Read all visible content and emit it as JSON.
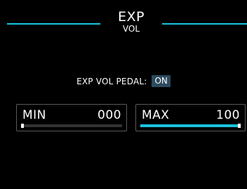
{
  "colors": {
    "accent": "#19c3df",
    "background": "#000000"
  },
  "header": {
    "title": "EXP",
    "subtitle": "VOL"
  },
  "pedal": {
    "label": "EXP VOL PEDAL:",
    "state": "ON"
  },
  "min": {
    "label": "MIN",
    "value": "000",
    "level": 0.0
  },
  "max": {
    "label": "MAX",
    "value": "100",
    "level": 1.0
  }
}
